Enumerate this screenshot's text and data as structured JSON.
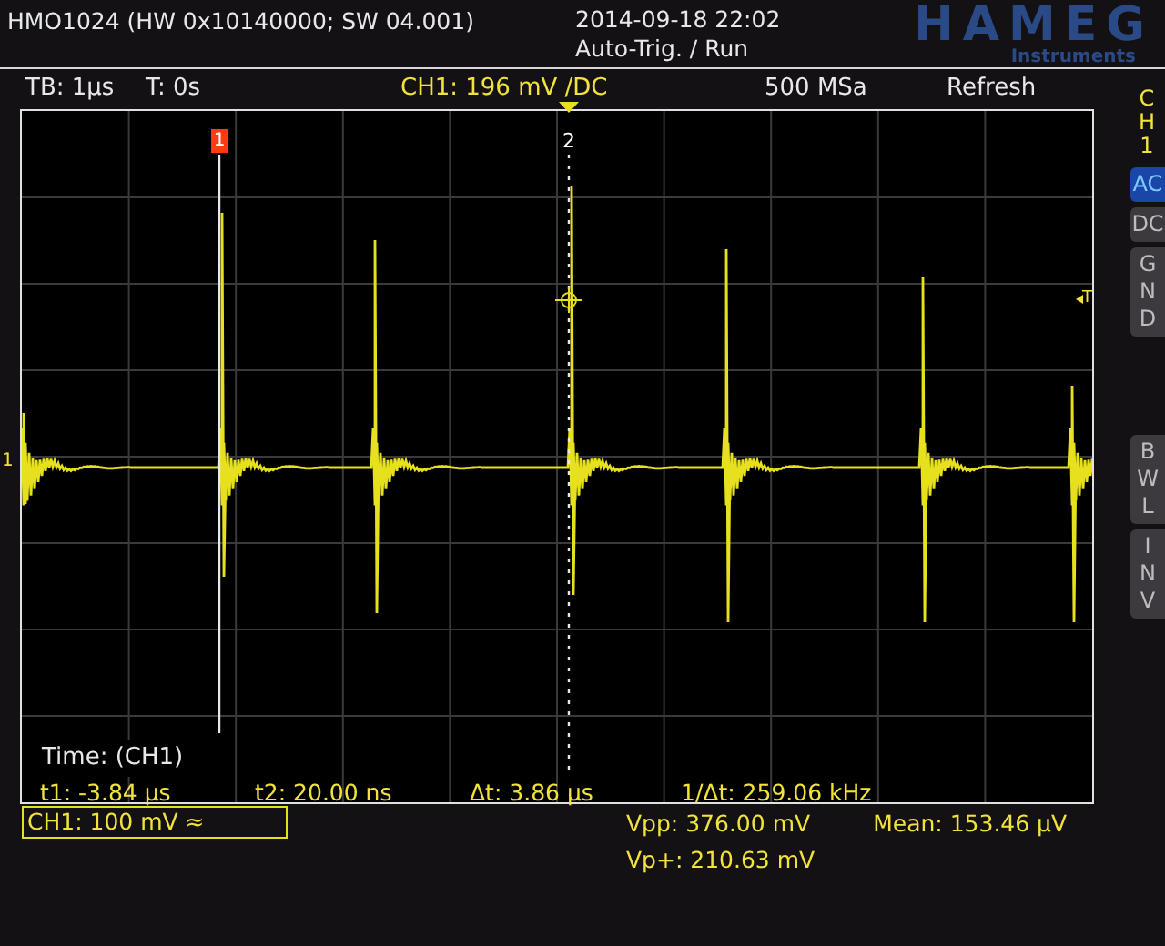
{
  "header": {
    "title": "HMO1024 (HW 0x10140000; SW 04.001)",
    "datetime": "2014-09-18 22:02",
    "trigger_status": "Auto-Trig. / Run",
    "logo": "HAMEG",
    "logo_subtitle": "Instruments"
  },
  "status_bar": [
    "TB: 1µs",
    "T: 0s",
    "CH1: 196 mV /DC",
    "500 MSa",
    "Refresh"
  ],
  "side_panel": {
    "channel": "CH1",
    "buttons": [
      {
        "label": "AC",
        "selected": true
      },
      {
        "label": "DC",
        "selected": false
      },
      {
        "label": "GND",
        "selected": false
      },
      {
        "label": "BWL",
        "selected": false
      },
      {
        "label": "INV",
        "selected": false
      }
    ]
  },
  "graticule": {
    "cursor_1": "1",
    "cursor_2": "2",
    "trigger_marker": "T",
    "ground_marker": "1",
    "readout": {
      "title": "Time: (CH1)",
      "values": [
        "t1: -3.84 µs",
        "t2: 20.00 ns",
        "Δt: 3.86 µs",
        "1/Δt: 259.06 kHz"
      ]
    }
  },
  "channel_setting": "CH1: 100 mV ≈",
  "measurements": [
    "Vpp: 376.00 mV",
    "Mean: 153.46 µV",
    "Vp+: 210.63 mV"
  ]
}
